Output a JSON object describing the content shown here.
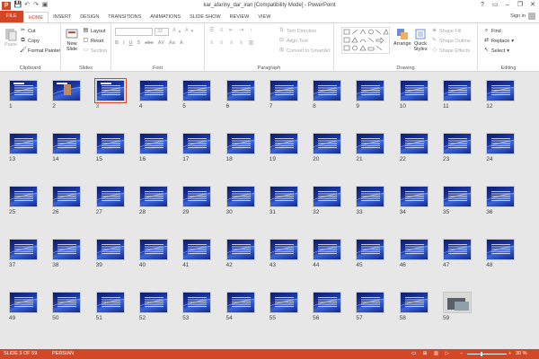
{
  "window": {
    "title": "kar_afariny_dar_iran [Compatibility Mode] - PowerPoint",
    "logo_letter": "P",
    "qat": {
      "save": "💾",
      "undo": "↶",
      "redo": "↷",
      "start": "▣"
    },
    "controls": {
      "help": "?",
      "ribbon_options": "▭",
      "minimize": "–",
      "restore": "❐",
      "close": "✕"
    }
  },
  "tabs": [
    "FILE",
    "HOME",
    "INSERT",
    "DESIGN",
    "TRANSITIONS",
    "ANIMATIONS",
    "SLIDE SHOW",
    "REVIEW",
    "VIEW"
  ],
  "signin": "Sign in",
  "ribbon": {
    "clipboard": {
      "label": "Clipboard",
      "paste": "Paste",
      "cut": "Cut",
      "copy": "Copy",
      "format_painter": "Format Painter"
    },
    "slides": {
      "label": "Slides",
      "new_slide": "New",
      "new_slide_2": "Slide",
      "layout": "Layout",
      "reset": "Reset",
      "section": "Section"
    },
    "font": {
      "label": "Font",
      "size": "32"
    },
    "paragraph": {
      "label": "Paragraph",
      "text_direction": "Text Direction",
      "align_text": "Align Text",
      "smartart": "Convert to SmartArt"
    },
    "drawing": {
      "label": "Drawing",
      "arrange": "Arrange",
      "quick_styles": "Quick",
      "quick_styles_2": "Styles",
      "shape_fill": "Shape Fill",
      "shape_outline": "Shape Outline",
      "shape_effects": "Shape Effects"
    },
    "editing": {
      "label": "Editing",
      "find": "Find",
      "replace": "Replace",
      "select": "Select"
    }
  },
  "sorter": {
    "selected": 3,
    "slides": [
      "1",
      "2",
      "3",
      "4",
      "5",
      "6",
      "7",
      "8",
      "9",
      "10",
      "11",
      "12",
      "13",
      "14",
      "15",
      "16",
      "17",
      "18",
      "19",
      "20",
      "21",
      "22",
      "23",
      "24",
      "25",
      "26",
      "27",
      "28",
      "29",
      "30",
      "31",
      "32",
      "33",
      "34",
      "35",
      "36",
      "37",
      "38",
      "39",
      "40",
      "41",
      "42",
      "43",
      "44",
      "45",
      "46",
      "47",
      "48",
      "49",
      "50",
      "51",
      "52",
      "53",
      "54",
      "55",
      "56",
      "57",
      "58",
      "59"
    ]
  },
  "status": {
    "slide_info": "SLIDE 3 OF 59",
    "language": "PERSIAN",
    "zoom": "30 %"
  },
  "colors": {
    "accent": "#d24726",
    "slide_bg": "#1d3aa8"
  }
}
